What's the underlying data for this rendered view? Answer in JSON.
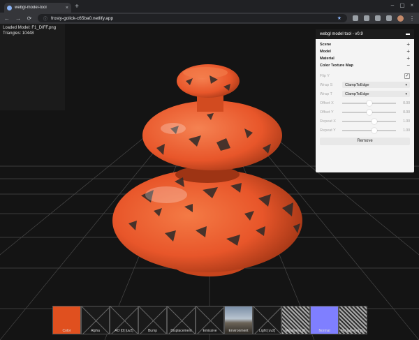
{
  "browser": {
    "tab_title": "webgl-model-tool",
    "tab_close": "×",
    "new_tab": "+",
    "url": "frosty-golick-c65ba0.netlify.app",
    "win_min": "–",
    "win_max": "▢",
    "win_close": "×",
    "back": "←",
    "forward": "→",
    "reload": "⟳",
    "lock": "ⓘ",
    "star": "★",
    "menu": "⋮"
  },
  "info": {
    "loaded": "Loaded Model: F1_DIFF.png",
    "triangles": "Triangles: 10448"
  },
  "gui": {
    "title": "webgl model tool - v0.9",
    "folders": [
      {
        "label": "Scene",
        "state": "+"
      },
      {
        "label": "Model",
        "state": "+"
      },
      {
        "label": "Material",
        "state": "+"
      },
      {
        "label": "Color Texture Map",
        "state": "−"
      }
    ],
    "flip_y": {
      "label": "Flip Y",
      "checked": "✓"
    },
    "wrap_s": {
      "label": "Wrap S",
      "value": "ClampToEdge"
    },
    "wrap_t": {
      "label": "Wrap T",
      "value": "ClampToEdge"
    },
    "offset_x": {
      "label": "Offset X",
      "value": "0.00",
      "level": 0.5
    },
    "offset_y": {
      "label": "Offset Y",
      "value": "0.00",
      "level": 0.5
    },
    "repeat_x": {
      "label": "Repeat X",
      "value": "1.00",
      "level": 0.6
    },
    "repeat_y": {
      "label": "Repeat Y",
      "value": "1.00",
      "level": 0.6
    },
    "remove": "Remove"
  },
  "maps": [
    {
      "label": "Color",
      "type": "color",
      "fill": "#e0501f"
    },
    {
      "label": "Alpha",
      "type": "empty"
    },
    {
      "label": "AO [0] [uv2]",
      "type": "empty"
    },
    {
      "label": "Bump",
      "type": "empty"
    },
    {
      "label": "Displacement",
      "type": "empty"
    },
    {
      "label": "Emissive",
      "type": "empty"
    },
    {
      "label": "Environment",
      "type": "env"
    },
    {
      "label": "Light [uv2]",
      "type": "empty"
    },
    {
      "label": "Metalness [B]",
      "type": "noise"
    },
    {
      "label": "Normal",
      "type": "color",
      "fill": "#7f7fff"
    },
    {
      "label": "Roughness [G]",
      "type": "noise"
    }
  ],
  "colors": {
    "model": "#e8562a",
    "grid": "#4a4a4a",
    "accent": "#8ab4f8"
  }
}
